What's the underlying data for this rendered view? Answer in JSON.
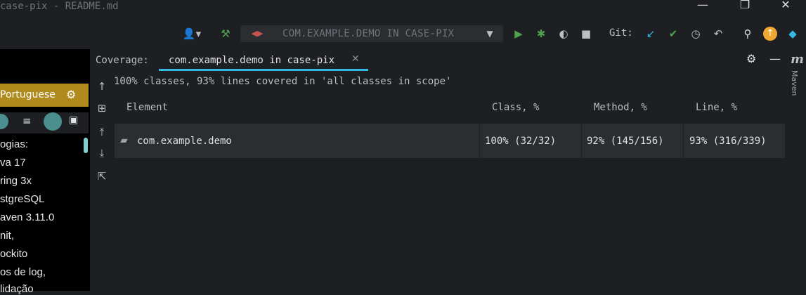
{
  "window": {
    "title": "case-pix - README.md",
    "minimize": "—",
    "restore": "❐",
    "close": "✕"
  },
  "toolbar": {
    "run_config": "COM.EXAMPLE.DEMO IN CASE-PIX",
    "git_label": "Git:",
    "colors": {
      "run": "#4fa34f",
      "accent": "#35b9e1",
      "update": "#f0a732"
    }
  },
  "editor": {
    "language_label": "Portuguese",
    "lines": [
      "ogias:",
      "va 17",
      "ring 3x",
      "stgreSQL",
      "aven 3.11.0",
      "nit,",
      "ockito",
      "os de log,",
      "lidação"
    ]
  },
  "coverage": {
    "header_label": "Coverage:",
    "tab_label": "com.example.demo in case-pix",
    "summary": "100% classes, 93% lines covered in 'all classes in scope'",
    "columns": [
      "Element",
      "Class, %",
      "Method, %",
      "Line, %"
    ],
    "rows": [
      {
        "element": "com.example.demo",
        "class": "100% (32/32)",
        "method": "92% (145/156)",
        "line": "93% (316/339)"
      }
    ]
  },
  "right_strip": {
    "maven_label": "Maven",
    "m_glyph": "m"
  }
}
